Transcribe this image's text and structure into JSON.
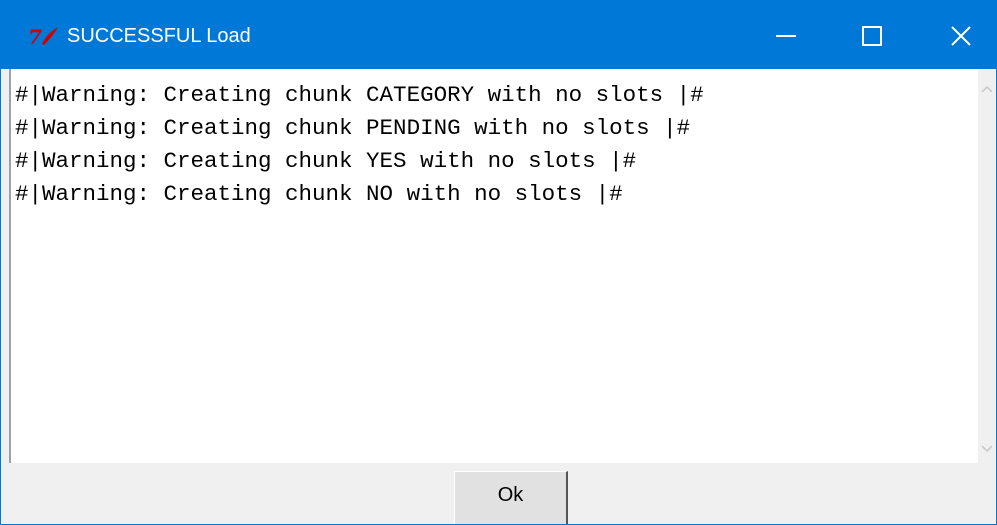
{
  "window": {
    "title": "SUCCESSFUL Load",
    "title_bar_color": "#0078d7",
    "app_icon": "tk-feather-icon",
    "controls": {
      "minimize": "minimize-icon",
      "maximize": "maximize-icon",
      "close": "close-icon"
    }
  },
  "output": {
    "lines": [
      "#|Warning: Creating chunk CATEGORY with no slots |#",
      "#|Warning: Creating chunk PENDING with no slots |#",
      "#|Warning: Creating chunk YES with no slots |#",
      "#|Warning: Creating chunk NO with no slots |#"
    ]
  },
  "buttons": {
    "ok_label": "Ok"
  }
}
